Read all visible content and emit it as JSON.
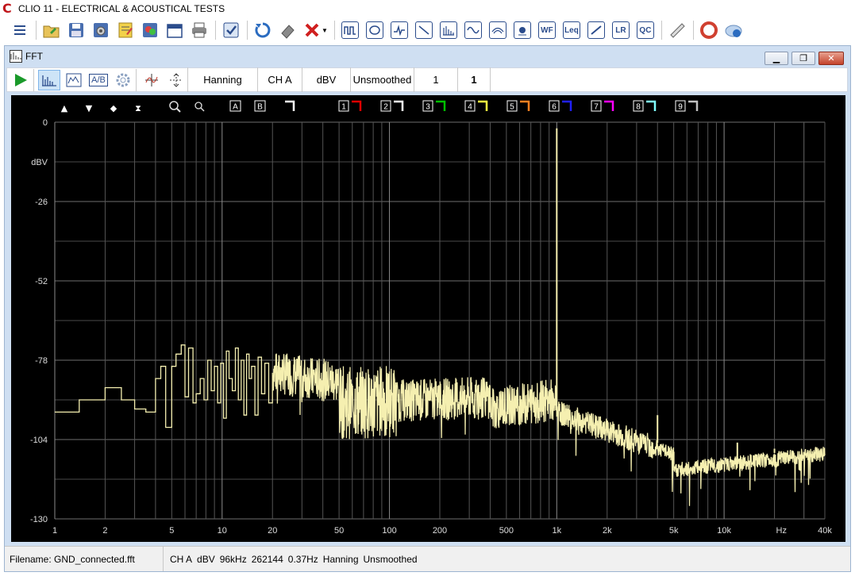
{
  "app": {
    "title": "CLIO 11 - ELECTRICAL & ACOUSTICAL TESTS",
    "logo": "C"
  },
  "main_toolbar": {
    "icons": [
      "menu-icon",
      "open-folder-icon",
      "save-icon",
      "settings-save-icon",
      "notes-icon",
      "image-icon",
      "calendar-icon",
      "print-icon",
      "check-icon",
      "refresh-icon",
      "eraser-icon",
      "delete-icon",
      "dropdown-arrow-icon",
      "mls-icon",
      "sinusoidal-icon",
      "waveform-icon",
      "sweep-icon",
      "fft-icon",
      "sine-icon",
      "waterfall-icon",
      "tweeter-icon",
      "wf-icon",
      "leq-icon",
      "multimeter-icon",
      "lr-icon",
      "qc-icon",
      "ruler-icon",
      "help-icon",
      "cloud-help-icon"
    ],
    "wf_label": "WF",
    "leq_label": "Leq",
    "lr_label": "LR",
    "qc_label": "QC"
  },
  "fft_window": {
    "title": "FFT",
    "icon_label": "FFT"
  },
  "fft_toolbar": {
    "window": "Hanning",
    "channel": "CH A",
    "units": "dBV",
    "smoothing": "Unsmoothed",
    "averages": "1",
    "value2": "1",
    "ab_label": "A/B"
  },
  "chart_overlay": {
    "marker_a": "A",
    "marker_b": "B",
    "overlays": [
      "1",
      "2",
      "3",
      "4",
      "5",
      "6",
      "7",
      "8",
      "9"
    ],
    "overlay_colors": [
      "#e00000",
      "#ffffff",
      "#00c000",
      "#ffff40",
      "#ff8020",
      "#2020ff",
      "#ff00ff",
      "#80ffff",
      "#c0c0c0"
    ]
  },
  "chart_data": {
    "type": "line",
    "xscale": "log",
    "xlim": [
      1,
      40000
    ],
    "ylim": [
      -130,
      0
    ],
    "yticks": [
      0,
      -26,
      -52,
      -78,
      -104,
      -130
    ],
    "ytick_labels": [
      "0",
      "-26",
      "-52",
      "-78",
      "-104",
      "-130"
    ],
    "ylabel": "dBV",
    "xticks": [
      1,
      2,
      5,
      10,
      20,
      50,
      100,
      200,
      500,
      1000,
      2000,
      5000,
      10000,
      40000
    ],
    "xtick_labels": [
      "1",
      "2",
      "5",
      "10",
      "20",
      "50",
      "100",
      "200",
      "500",
      "1k",
      "2k",
      "5k",
      "10k",
      "40k"
    ],
    "xunit_label": "Hz",
    "grid": true,
    "line_color": "#f5efb0",
    "series": [
      {
        "name": "",
        "stepped_low": [
          [
            1,
            -95
          ],
          [
            1.4,
            -95
          ],
          [
            1.4,
            -91
          ],
          [
            2,
            -91
          ],
          [
            2,
            -87
          ],
          [
            2.5,
            -87
          ],
          [
            2.5,
            -91
          ],
          [
            3,
            -91
          ],
          [
            3,
            -94
          ],
          [
            3.5,
            -94
          ],
          [
            3.5,
            -95
          ],
          [
            4,
            -95
          ],
          [
            4,
            -84
          ],
          [
            4.3,
            -84
          ],
          [
            4.3,
            -80
          ],
          [
            4.6,
            -80
          ],
          [
            4.6,
            -100
          ],
          [
            5,
            -100
          ],
          [
            5,
            -80
          ],
          [
            5.3,
            -80
          ],
          [
            5.3,
            -76
          ],
          [
            5.7,
            -76
          ],
          [
            5.7,
            -73
          ],
          [
            6,
            -73
          ],
          [
            6,
            -90
          ],
          [
            6.3,
            -90
          ],
          [
            6.3,
            -74
          ],
          [
            6.7,
            -74
          ],
          [
            6.7,
            -92
          ],
          [
            7,
            -92
          ],
          [
            7,
            -89
          ],
          [
            7.4,
            -89
          ],
          [
            7.4,
            -84
          ],
          [
            7.8,
            -84
          ],
          [
            7.8,
            -91
          ],
          [
            8.2,
            -91
          ],
          [
            8.2,
            -78
          ],
          [
            8.6,
            -78
          ],
          [
            8.6,
            -88
          ],
          [
            9,
            -88
          ],
          [
            9,
            -80
          ],
          [
            9.4,
            -80
          ],
          [
            9.4,
            -92
          ],
          [
            9.8,
            -92
          ],
          [
            9.8,
            -79
          ],
          [
            10.2,
            -79
          ],
          [
            10.2,
            -97
          ],
          [
            10.6,
            -97
          ],
          [
            10.6,
            -75
          ],
          [
            11,
            -75
          ],
          [
            11,
            -84
          ],
          [
            11.5,
            -84
          ],
          [
            11.5,
            -88
          ],
          [
            12,
            -88
          ],
          [
            12,
            -74
          ],
          [
            12.5,
            -74
          ],
          [
            12.5,
            -91
          ],
          [
            13,
            -91
          ],
          [
            13,
            -78
          ],
          [
            13.5,
            -78
          ],
          [
            13.5,
            -96
          ],
          [
            14,
            -96
          ],
          [
            14,
            -76
          ],
          [
            14.5,
            -76
          ],
          [
            14.5,
            -84
          ],
          [
            15,
            -84
          ],
          [
            15,
            -80
          ],
          [
            15.7,
            -80
          ],
          [
            15.7,
            -96
          ],
          [
            16.4,
            -96
          ],
          [
            16.4,
            -77
          ],
          [
            17.2,
            -77
          ],
          [
            17.2,
            -89
          ],
          [
            18,
            -89
          ],
          [
            18,
            -79
          ],
          [
            19,
            -79
          ],
          [
            19,
            -92
          ],
          [
            20,
            -92
          ]
        ],
        "peaks": [
          [
            1000,
            -2
          ],
          [
            2000,
            -102
          ],
          [
            3000,
            -104
          ],
          [
            4000,
            -96
          ],
          [
            5000,
            -108
          ],
          [
            10000,
            -110
          ],
          [
            12000,
            -105
          ],
          [
            20000,
            -107
          ],
          [
            15000,
            -112
          ]
        ]
      }
    ]
  },
  "status_bar": {
    "filename": "Filename: GND_connected.fft",
    "channel": "CH A",
    "units": "dBV",
    "rate": "96kHz",
    "size": "262144",
    "resolution": "0.37Hz",
    "window": "Hanning",
    "smoothing": "Unsmoothed"
  }
}
